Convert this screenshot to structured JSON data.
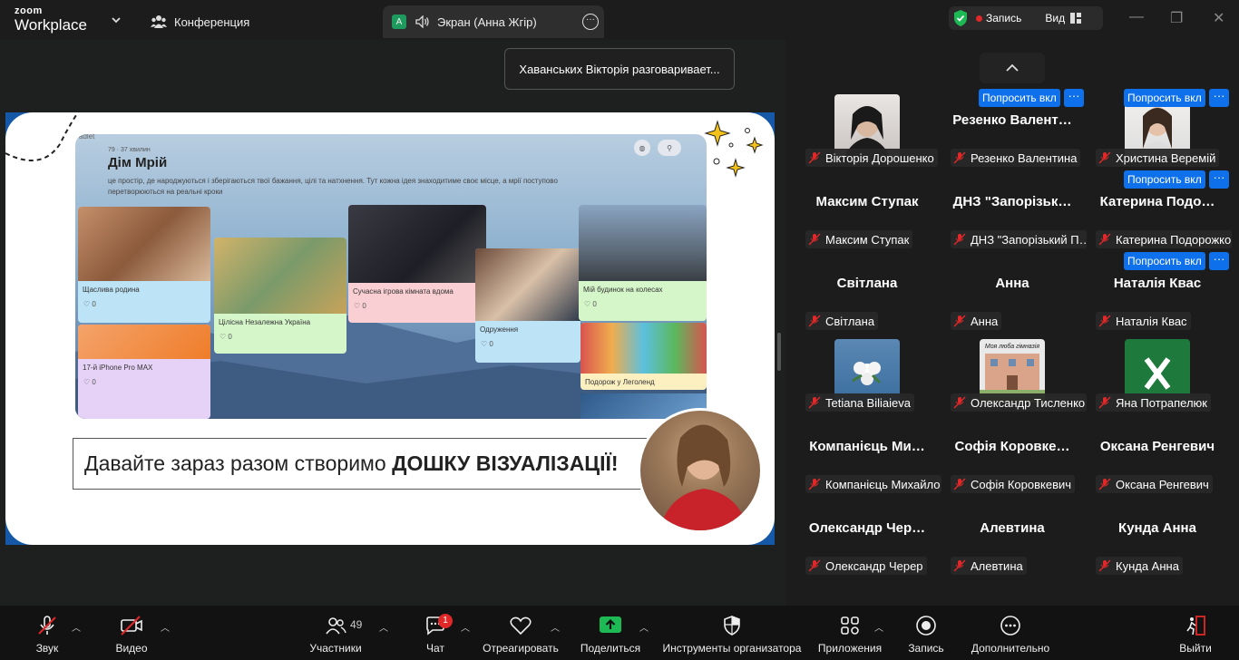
{
  "app": {
    "logo_line1": "zoom",
    "logo_line2": "Workplace",
    "tab_conference": "Конференция",
    "tab_screen_avatar": "A",
    "tab_screen": "Экран (Анна Жгір)",
    "record_label": "Запись",
    "view_label": "Вид"
  },
  "toast": "Хаванських Вікторія разговаривает...",
  "slide": {
    "padlet_meta": "79 · 37 хвилин",
    "padlet_brand": "adlet",
    "padlet_title": "Дім Мрій",
    "padlet_desc": "це простір, де народжуються і зберігаються твої бажання, цілі та натхнення. Тут кожна ідея знаходитиме своє місце, а мрії поступово перетворюються на реальні кроки",
    "cards": [
      {
        "title": "Щаслива родина",
        "likes": "0"
      },
      {
        "title": "17-й iPhone Pro MAX",
        "likes": "0"
      },
      {
        "title": "Цілісна Незалежна Україна",
        "likes": "0"
      },
      {
        "title": "Сучасна ігрова кімната вдома",
        "likes": "0"
      },
      {
        "title": "Одруження",
        "likes": "0"
      },
      {
        "title": "Мій будинок на колесах",
        "likes": "0"
      },
      {
        "title": "Подорож у Леголенд",
        "likes": ""
      }
    ],
    "caption_normal": "Давайте зараз разом створимо ",
    "caption_bold": "ДОШКУ ВІЗУАЛІЗАЦІЇ!"
  },
  "gallery": {
    "ask_unmute": "Попросить вкл",
    "more": "···",
    "tiles": [
      {
        "name": "",
        "label": "Вікторія Дорошенко"
      },
      {
        "name": "Резенко  Валент…",
        "label": "Резенко Валентина"
      },
      {
        "name": "",
        "label": "Христина Веремій"
      },
      {
        "name": "Максим Ступак",
        "label": "Максим Ступак"
      },
      {
        "name": "ДНЗ  \"Запорізьк…",
        "label": "ДНЗ \"Запорізький П…"
      },
      {
        "name": "Катерина  Подо…",
        "label": "Катерина Подорожко"
      },
      {
        "name": "Світлана",
        "label": "Світлана"
      },
      {
        "name": "Анна",
        "label": "Анна"
      },
      {
        "name": "Наталія Квас",
        "label": "Наталія Квас"
      },
      {
        "name": "",
        "label": "Tetiana Biliaieva"
      },
      {
        "name": "",
        "label": "Олександр Тисленко"
      },
      {
        "name": "",
        "label": "Яна Потрапелюк"
      },
      {
        "name": "Компанієць  Ми…",
        "label": "Компанієць Михайло"
      },
      {
        "name": "Софія  Коровке…",
        "label": "Софія Коровкевич"
      },
      {
        "name": "Оксана Ренгевич",
        "label": "Оксана Ренгевич"
      },
      {
        "name": "Олександр  Чер…",
        "label": "Олександр Черер"
      },
      {
        "name": "Алевтина",
        "label": "Алевтина"
      },
      {
        "name": "Кунда Анна",
        "label": "Кунда Анна"
      }
    ],
    "school_sign": "Моя люба гімназія"
  },
  "toolbar": {
    "audio": "Звук",
    "video": "Видео",
    "participants": "Участники",
    "participants_count": "49",
    "chat": "Чат",
    "chat_badge": "1",
    "react": "Отреагировать",
    "share": "Поделиться",
    "host_tools": "Инструменты организатора",
    "apps": "Приложения",
    "record": "Запись",
    "more": "Дополнительно",
    "leave": "Выйти"
  }
}
